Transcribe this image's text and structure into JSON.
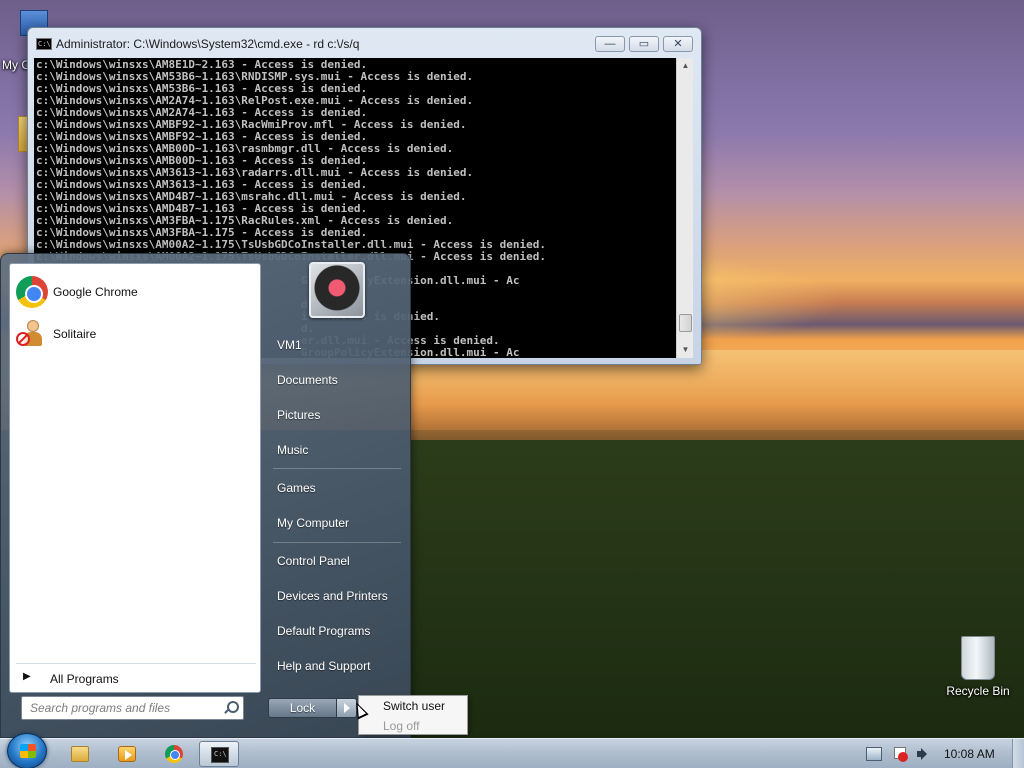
{
  "desktop": {
    "partial_icon_label": "My C",
    "recycle_bin_label": "Recycle Bin"
  },
  "cmd_window": {
    "title": "Administrator: C:\\Windows\\System32\\cmd.exe - rd  c:\\/s/q",
    "scroll_position": 0.96,
    "lines": [
      "c:\\Windows\\winsxs\\AM8E1D~2.163 - Access is denied.",
      "c:\\Windows\\winsxs\\AM53B6~1.163\\RNDISMP.sys.mui - Access is denied.",
      "c:\\Windows\\winsxs\\AM53B6~1.163 - Access is denied.",
      "c:\\Windows\\winsxs\\AM2A74~1.163\\RelPost.exe.mui - Access is denied.",
      "c:\\Windows\\winsxs\\AM2A74~1.163 - Access is denied.",
      "c:\\Windows\\winsxs\\AMBF92~1.163\\RacWmiProv.mfl - Access is denied.",
      "c:\\Windows\\winsxs\\AMBF92~1.163 - Access is denied.",
      "c:\\Windows\\winsxs\\AMB00D~1.163\\rasmbmgr.dll - Access is denied.",
      "c:\\Windows\\winsxs\\AMB00D~1.163 - Access is denied.",
      "c:\\Windows\\winsxs\\AM3613~1.163\\radarrs.dll.mui - Access is denied.",
      "c:\\Windows\\winsxs\\AM3613~1.163 - Access is denied.",
      "c:\\Windows\\winsxs\\AMD4B7~1.163\\msrahc.dll.mui - Access is denied.",
      "c:\\Windows\\winsxs\\AMD4B7~1.163 - Access is denied.",
      "c:\\Windows\\winsxs\\AM3FBA~1.175\\RacRules.xml - Access is denied.",
      "c:\\Windows\\winsxs\\AM3FBA~1.175 - Access is denied.",
      "c:\\Windows\\winsxs\\AM00A2~1.175\\TsUsbGDCoInstaller.dll.mui - Access is denied.",
      "c:\\Windows\\winsxs\\AM00A2~1.175\\TsUsbGDCoInstaller.dll.mui - Access is denied.",
      "",
      "                                        GroupPolicyExtension.dll.mui - Ac",
      "",
      "                                        d.",
      "                                        i - Access is denied.",
      "                                        d.",
      "                                        er.dll.mui - Access is denied.",
      "                                        GroupPolicyExtension.dll.mui - Ac",
      "",
      "                                        d."
    ],
    "buttons": {
      "minimize": "—",
      "maximize": "▭",
      "close": "✕"
    }
  },
  "start_menu": {
    "pinned_programs": [
      {
        "name": "Google Chrome",
        "icon": "chrome-icon"
      },
      {
        "name": "Solitaire",
        "icon": "solitaire-icon"
      }
    ],
    "all_programs_label": "All Programs",
    "search": {
      "placeholder": "Search programs and files",
      "value": ""
    },
    "right_items": [
      "VM1",
      "Documents",
      "Pictures",
      "Music",
      "Games",
      "My Computer",
      "Control Panel",
      "Devices and Printers",
      "Default Programs",
      "Help and Support"
    ],
    "lock_label": "Lock",
    "power_submenu": {
      "items": [
        "Switch user",
        "Log off"
      ]
    }
  },
  "taskbar": {
    "pinned": [
      "explorer-icon",
      "media-player-icon",
      "chrome-icon",
      "cmd-icon"
    ],
    "active": "cmd-icon",
    "clock": "10:08 AM"
  },
  "colors": {
    "console_bg": "#000000",
    "console_text": "#c0c0c0",
    "start_menu_bg": "#4a5b6e",
    "taskbar": "#aebdcd"
  }
}
